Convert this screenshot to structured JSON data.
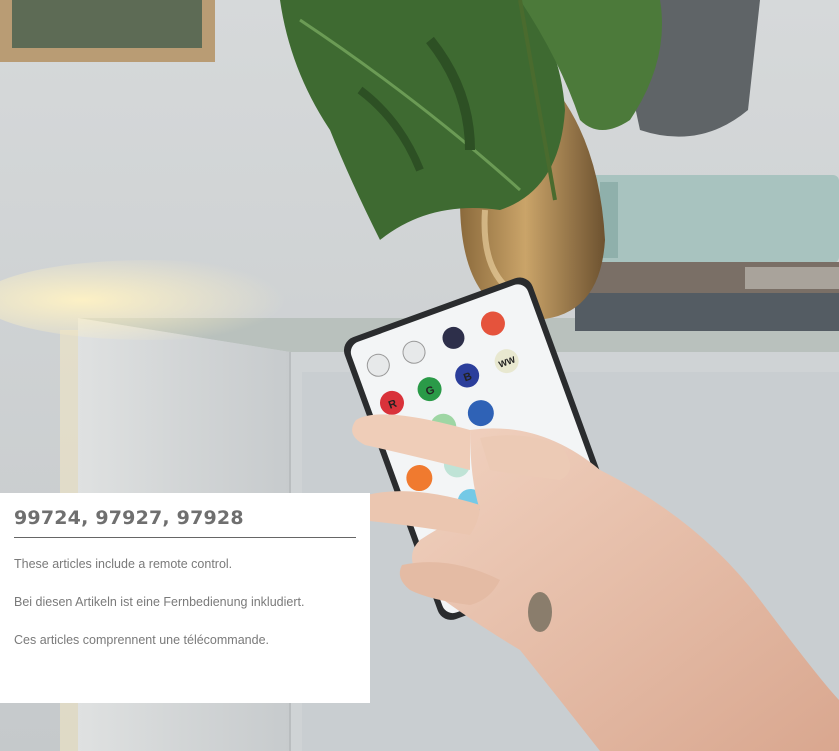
{
  "caption": {
    "title": "99724, 97927, 97928",
    "lines": [
      "These articles include a remote control.",
      "Bei diesen Artikeln ist eine Fernbedienung inkludiert.",
      "Ces articles comprennent une télécommande."
    ]
  },
  "remote": {
    "button_labels": [
      "R",
      "G",
      "B",
      "WW"
    ]
  },
  "colors": {
    "panel_background": "#ffffff",
    "title_text": "#6f6f6f",
    "body_text": "#7a7a7a",
    "rule": "#666666"
  }
}
